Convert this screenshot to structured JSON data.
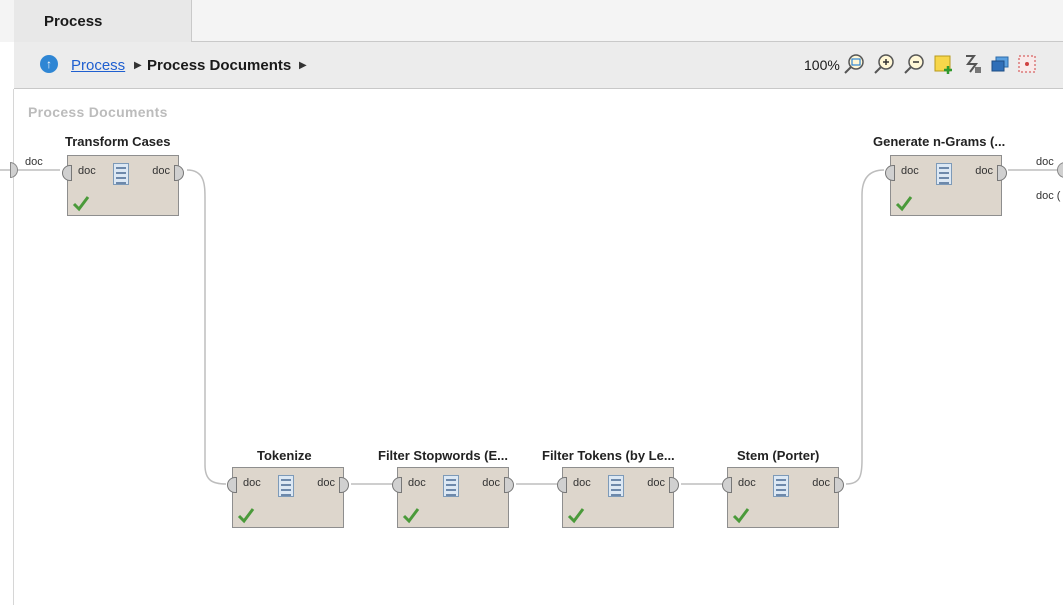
{
  "tab": {
    "label": "Process"
  },
  "breadcrumb": {
    "root_label": "Process",
    "current_label": "Process Documents",
    "separator": "▶"
  },
  "toolbar": {
    "zoom": "100%",
    "icons": [
      "zoom-fit-icon",
      "zoom-in-icon",
      "zoom-out-icon",
      "add-note-icon",
      "auto-wire-icon",
      "layer-icon",
      "arrange-icon"
    ]
  },
  "canvas": {
    "title": "Process Documents",
    "input_port_label": "doc",
    "output_port_labels": [
      "doc",
      "doc ("
    ]
  },
  "operators": [
    {
      "title": "Transform Cases",
      "in_port": "doc",
      "out_port": "doc",
      "status": "ok"
    },
    {
      "title": "Tokenize",
      "in_port": "doc",
      "out_port": "doc",
      "status": "ok"
    },
    {
      "title": "Filter Stopwords (E...",
      "in_port": "doc",
      "out_port": "doc",
      "status": "ok"
    },
    {
      "title": "Filter Tokens (by Le...",
      "in_port": "doc",
      "out_port": "doc",
      "status": "ok"
    },
    {
      "title": "Stem (Porter)",
      "in_port": "doc",
      "out_port": "doc",
      "status": "ok"
    },
    {
      "title": "Generate n-Grams (...",
      "in_port": "doc",
      "out_port": "doc",
      "status": "ok"
    }
  ],
  "colors": {
    "operator_fill": "#ddd6cc",
    "check_green": "#4a9a3a",
    "link_blue": "#1f5fd0",
    "wire": "#bdbdbd"
  }
}
